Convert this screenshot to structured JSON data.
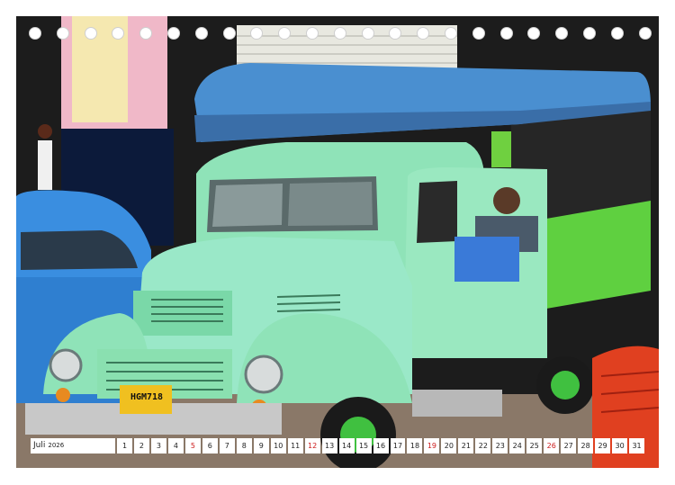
{
  "calendar": {
    "month": "Juli",
    "year": "2026",
    "days": [
      {
        "n": "1",
        "sun": false
      },
      {
        "n": "2",
        "sun": false
      },
      {
        "n": "3",
        "sun": false
      },
      {
        "n": "4",
        "sun": false
      },
      {
        "n": "5",
        "sun": true
      },
      {
        "n": "6",
        "sun": false
      },
      {
        "n": "7",
        "sun": false
      },
      {
        "n": "8",
        "sun": false
      },
      {
        "n": "9",
        "sun": false
      },
      {
        "n": "10",
        "sun": false
      },
      {
        "n": "11",
        "sun": false
      },
      {
        "n": "12",
        "sun": true
      },
      {
        "n": "13",
        "sun": false
      },
      {
        "n": "14",
        "sun": false
      },
      {
        "n": "15",
        "sun": false
      },
      {
        "n": "16",
        "sun": false
      },
      {
        "n": "17",
        "sun": false
      },
      {
        "n": "18",
        "sun": false
      },
      {
        "n": "19",
        "sun": true
      },
      {
        "n": "20",
        "sun": false
      },
      {
        "n": "21",
        "sun": false
      },
      {
        "n": "22",
        "sun": false
      },
      {
        "n": "23",
        "sun": false
      },
      {
        "n": "24",
        "sun": false
      },
      {
        "n": "25",
        "sun": false
      },
      {
        "n": "26",
        "sun": true
      },
      {
        "n": "27",
        "sun": false
      },
      {
        "n": "28",
        "sun": false
      },
      {
        "n": "29",
        "sun": false
      },
      {
        "n": "30",
        "sun": false
      },
      {
        "n": "31",
        "sun": false
      }
    ],
    "sunday_color": "#cc1a1a"
  },
  "photo": {
    "license_plate": "HGM718",
    "truck_color": "#8fe3b8",
    "canopy_color": "#4a8fd0",
    "bed_color": "#5fd040",
    "car_color": "#3a8ee0"
  }
}
